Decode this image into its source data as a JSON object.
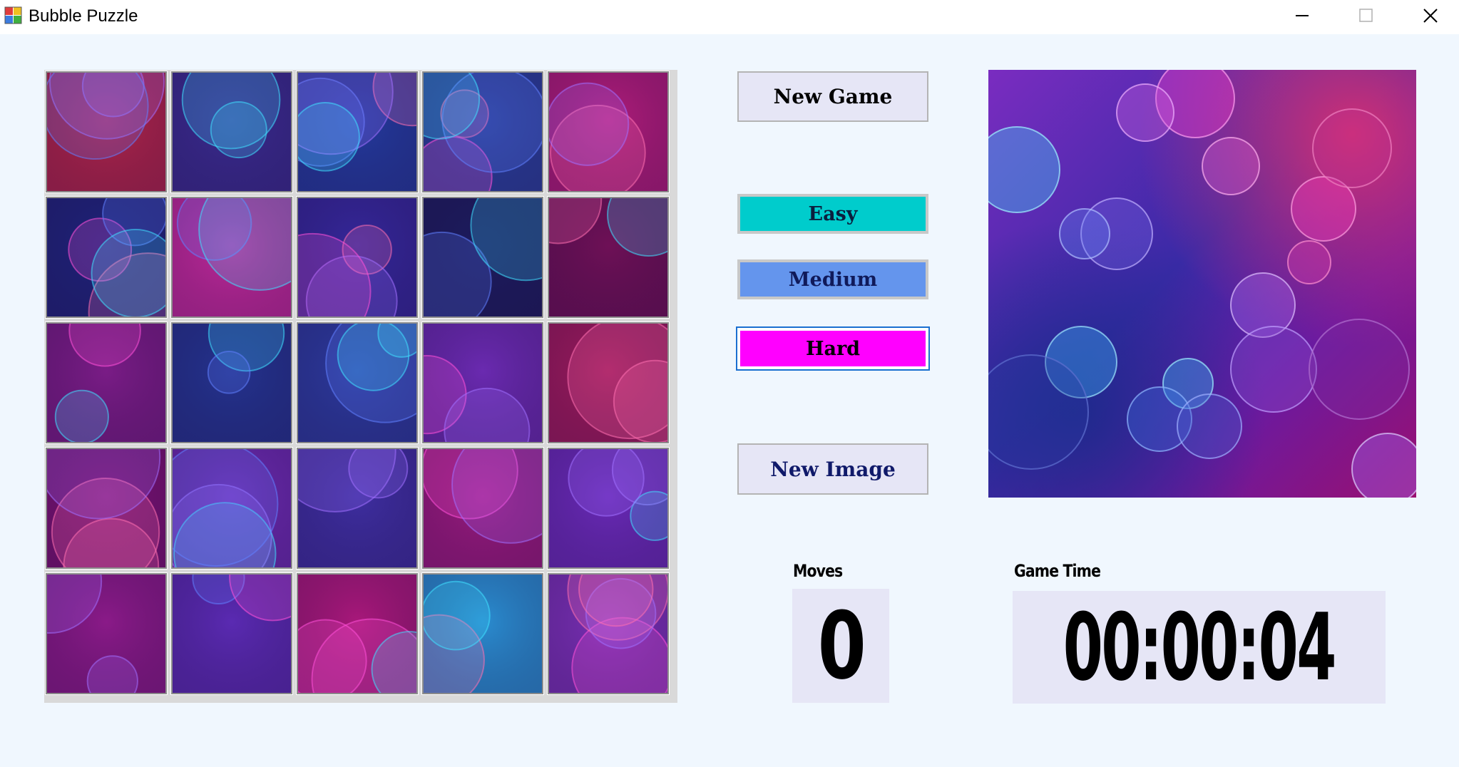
{
  "window": {
    "title": "Bubble Puzzle",
    "controls": [
      "minimize",
      "maximize",
      "close"
    ]
  },
  "toolbar": {
    "new_game_label": "New Game",
    "new_image_label": "New Image"
  },
  "difficulty": {
    "easy": {
      "label": "Easy",
      "color": "#00cccc"
    },
    "medium": {
      "label": "Medium",
      "color": "#6495ed"
    },
    "hard": {
      "label": "Hard",
      "color": "#ff00ff",
      "selected": true
    }
  },
  "stats": {
    "moves_label": "Moves",
    "moves_value": "0",
    "time_label": "Game Time",
    "time_value": "00:00:04"
  },
  "board": {
    "rows": 5,
    "cols": 5,
    "tile_colors": [
      [
        "#b0244a",
        "#3a2b8f",
        "#243a9e",
        "#2a3f9c",
        "#b01c7a"
      ],
      [
        "#1f237a",
        "#c0299a",
        "#35279a",
        "#1c1c5e",
        "#6e1056"
      ],
      [
        "#7a1c86",
        "#24338f",
        "#2c3a9e",
        "#6a2ab0",
        "#9e1a5c"
      ],
      [
        "#7a1272",
        "#6c2ab0",
        "#3e2ea0",
        "#9a1a7e",
        "#6a2ab8"
      ],
      [
        "#8a1a88",
        "#5a2ab2",
        "#a8187a",
        "#2a8cd0",
        "#7a30b6"
      ]
    ]
  }
}
